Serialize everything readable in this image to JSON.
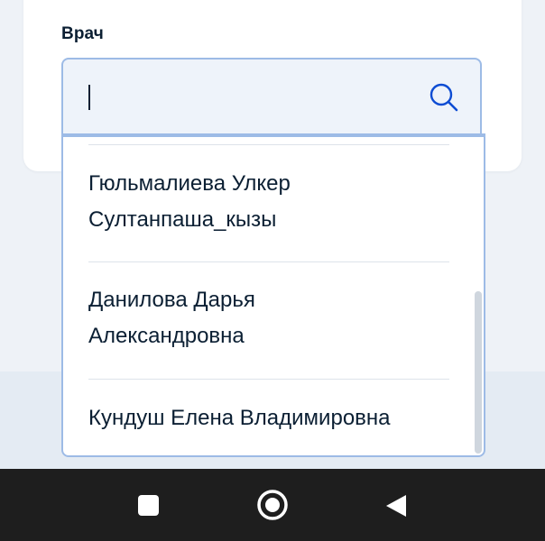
{
  "form": {
    "doctor_label": "Врач",
    "search": {
      "value": "",
      "placeholder": "",
      "icon": "search-icon"
    }
  },
  "dropdown": {
    "options": [
      {
        "line1": "Гюльмалиева Улкер",
        "line2": "Султанпаша_кызы"
      },
      {
        "line1": "Данилова Дарья",
        "line2": "Александровна"
      },
      {
        "line1": "Кундуш Елена Владимировна",
        "line2": ""
      }
    ]
  },
  "nav": {
    "recents_icon": "square-icon",
    "home_icon": "circle-icon",
    "back_icon": "back-triangle-icon"
  },
  "colors": {
    "accent": "#0d4cd3",
    "border": "#9dbbe6",
    "text": "#0b1f33"
  }
}
